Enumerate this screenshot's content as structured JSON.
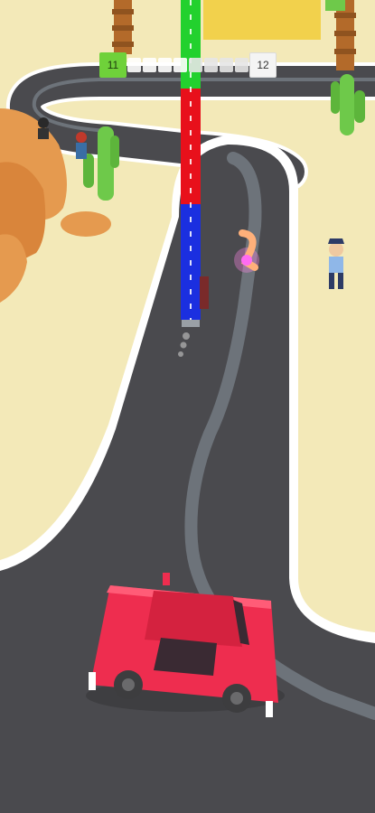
{
  "hud": {
    "current_level": "11",
    "next_level": "12",
    "progress_fraction": 0.5,
    "progress_segments": 8
  },
  "colors": {
    "sand": "#f3e9b8",
    "road": "#4a4a4e",
    "road_line": "#6d737a",
    "curb": "#ffffff",
    "car": "#ee2d4f",
    "rock": "#e59a4f",
    "cactus": "#6ec94a",
    "tower_green": "#22d12e",
    "tower_red": "#e8101b",
    "tower_blue": "#1b2fe0",
    "level_badge": "#6fd13a"
  },
  "icons": {
    "tower": "stacked-color-tower",
    "car": "red-car",
    "pickup": "glowing-pickup",
    "npc": "bystander"
  }
}
